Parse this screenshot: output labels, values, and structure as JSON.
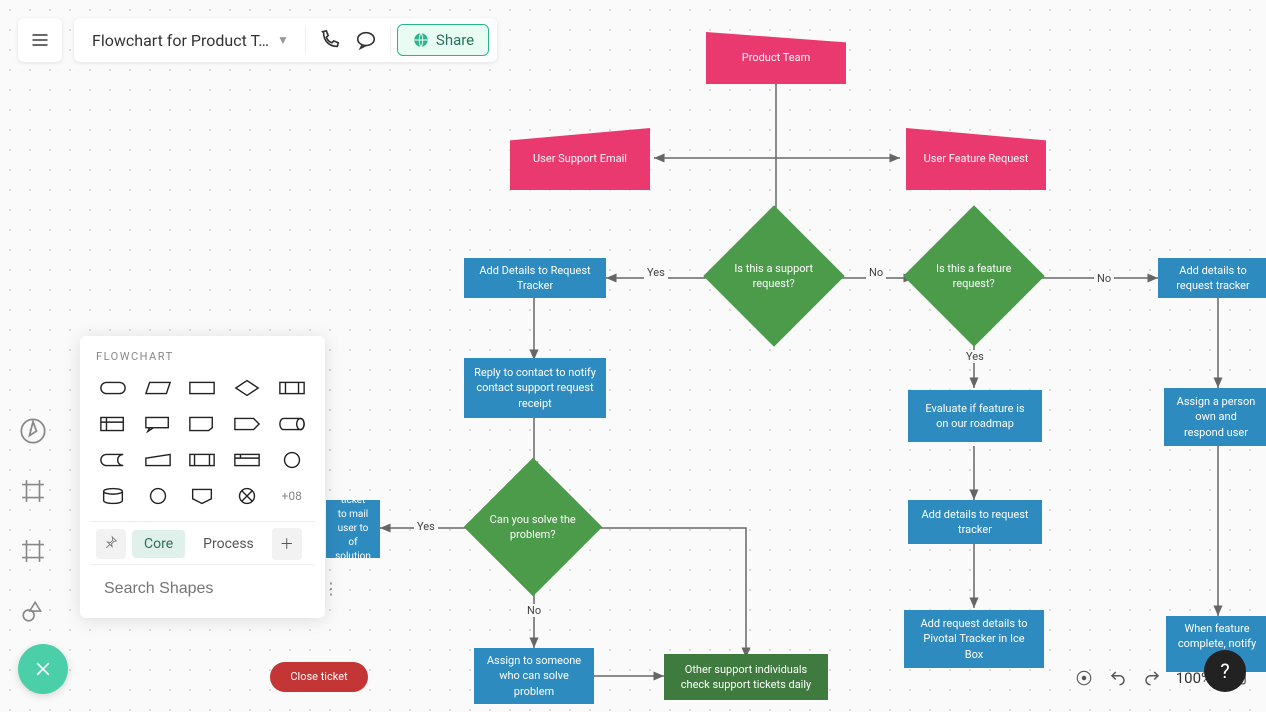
{
  "header": {
    "doc_title": "Flowchart for Product T…",
    "share_label": "Share"
  },
  "shapes_panel": {
    "title": "FLOWCHART",
    "more_count": "+08",
    "tabs": {
      "pin": "",
      "core": "Core",
      "process": "Process"
    },
    "search_placeholder": "Search Shapes"
  },
  "zoom": {
    "level": "100%"
  },
  "labels": {
    "yes1": "Yes",
    "no1": "No",
    "yes2": "Yes",
    "no2": "No",
    "yes3": "Yes",
    "no3": "No"
  },
  "nodes": {
    "product_team": "Product Team",
    "user_support_email": "User Support Email",
    "user_feature_request": "User Feature Request",
    "is_support": "Is this a support request?",
    "is_feature": "Is this a feature request?",
    "add_details_tracker_left": "Add Details to Request Tracker",
    "add_details_tracker_right": "Add details to request tracker",
    "reply_contact": "Reply to contact to notify contact support request receipt",
    "assign_person": "Assign a person own and respond user",
    "can_solve": "Can you solve the problem?",
    "evaluate_roadmap": "Evaluate if feature is on our roadmap",
    "add_details_tracker2": "Add details to request tracker",
    "ticket_email": "ticket to mail user to of solution",
    "assign_someone": "Assign to someone who can solve problem",
    "other_support": "Other support individuals check support tickets daily",
    "pivotal": "Add request details to Pivotal Tracker in Ice Box",
    "when_complete": "When feature complete, notify it",
    "close_ticket": "Close ticket"
  }
}
